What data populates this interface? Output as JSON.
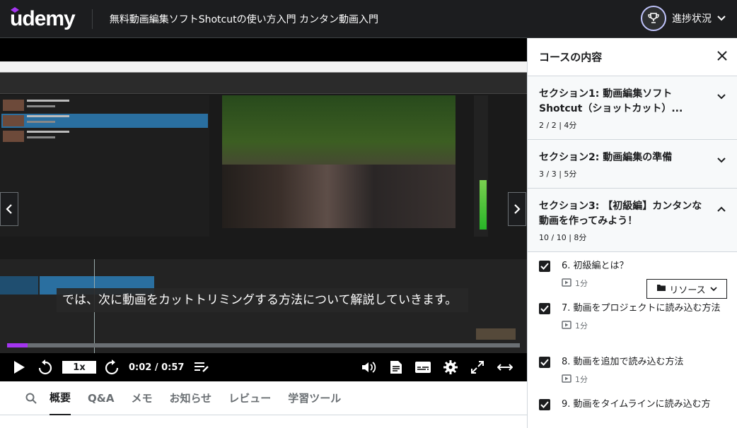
{
  "header": {
    "logo": "udemy",
    "course_title": "無料動画編集ソフトShotcutの使い方入門 カンタン動画入門",
    "progress_label": "進捗状況"
  },
  "player": {
    "subtitle": "では、次に動画をカットトリミングする方法について解説していきます。",
    "speed": "1x",
    "time": "0:02 / 0:57",
    "progress_fraction": 0.04,
    "accent": "#a435f0"
  },
  "tabs": [
    "概要",
    "Q&A",
    "メモ",
    "お知らせ",
    "レビュー",
    "学習ツール"
  ],
  "sidebar": {
    "title": "コースの内容",
    "sections": [
      {
        "title": "セクション1: 動画編集ソフトShotcut（ショットカット）...",
        "meta": "2 / 2 | 4分",
        "expanded": false
      },
      {
        "title": "セクション2: 動画編集の準備",
        "meta": "3 / 3 | 5分",
        "expanded": false
      },
      {
        "title": "セクション3: 【初級編】カンタンな動画を作ってみよう！",
        "meta": "10 / 10 | 8分",
        "expanded": true
      }
    ],
    "lessons": [
      {
        "title": "6. 初級編とは？",
        "duration": "1分",
        "checked": true,
        "resource": "リソース"
      },
      {
        "title": "7. 動画をプロジェクトに読み込む方法",
        "duration": "1分",
        "checked": true
      },
      {
        "title": "8. 動画を追加で読み込む方法",
        "duration": "1分",
        "checked": true
      },
      {
        "title": "9. 動画をタイムラインに読み込む方",
        "duration": "",
        "checked": true
      }
    ]
  }
}
